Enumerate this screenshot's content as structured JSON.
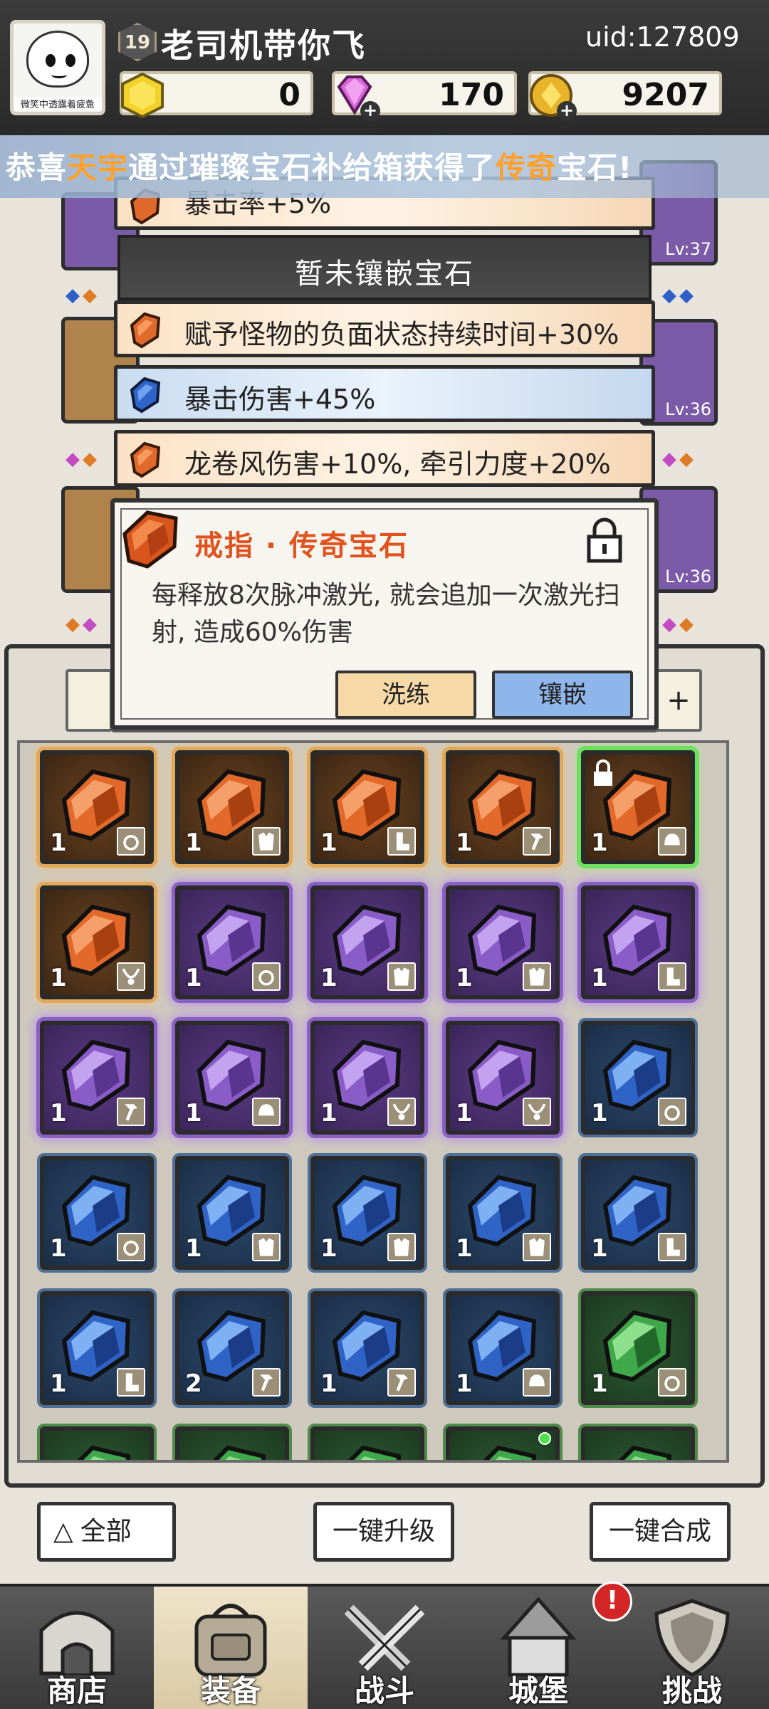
{
  "header": {
    "avatar_caption": "微笑中透露着疲惫",
    "level": "19",
    "player_name": "老司机带你飞",
    "uid": "uid:127809",
    "currencies": [
      {
        "icon": "gold-hexagon-icon",
        "value": "0"
      },
      {
        "icon": "purple-diamond-icon",
        "value": "170"
      },
      {
        "icon": "gold-coin-icon",
        "value": "9207"
      }
    ]
  },
  "marquee": {
    "prefix": "恭喜",
    "player": "天宇",
    "middle": "通过璀璨宝石补给箱获得了",
    "item": "传奇",
    "suffix": "宝石!"
  },
  "equipment_levels": [
    "Lv:37",
    "Lv:36",
    "Lv:36"
  ],
  "attributes": {
    "top_partial": "暴击率+5%",
    "empty_slot": "暂未镶嵌宝石",
    "list": [
      {
        "text": "赋予怪物的负面状态持续时间+30%",
        "gem": "orange"
      },
      {
        "text": "暴击伤害+45%",
        "gem": "blue"
      },
      {
        "text": "龙卷风伤害+10%, 牵引力度+20%",
        "gem": "orange"
      }
    ]
  },
  "popup": {
    "title": "戒指 · 传奇宝石",
    "description": "每释放8次脉冲激光, 就会追加一次激光扫射, 造成60%伤害",
    "refine_label": "洗练",
    "inlay_label": "镶嵌"
  },
  "inventory": {
    "tab_right": "+",
    "cells": [
      {
        "rarity": "orange",
        "count": "1",
        "slot": "ring"
      },
      {
        "rarity": "orange",
        "count": "1",
        "slot": "armor"
      },
      {
        "rarity": "orange",
        "count": "1",
        "slot": "boots"
      },
      {
        "rarity": "orange",
        "count": "1",
        "slot": "weapon"
      },
      {
        "rarity": "orange",
        "count": "1",
        "slot": "helmet",
        "locked": true,
        "selected": true
      },
      {
        "rarity": "orange",
        "count": "1",
        "slot": "necklace"
      },
      {
        "rarity": "purple",
        "count": "1",
        "slot": "ring"
      },
      {
        "rarity": "purple",
        "count": "1",
        "slot": "armor"
      },
      {
        "rarity": "purple",
        "count": "1",
        "slot": "armor"
      },
      {
        "rarity": "purple",
        "count": "1",
        "slot": "boots"
      },
      {
        "rarity": "purple",
        "count": "1",
        "slot": "weapon"
      },
      {
        "rarity": "purple",
        "count": "1",
        "slot": "helmet"
      },
      {
        "rarity": "purple",
        "count": "1",
        "slot": "necklace"
      },
      {
        "rarity": "purple",
        "count": "1",
        "slot": "necklace"
      },
      {
        "rarity": "blue",
        "count": "1",
        "slot": "ring"
      },
      {
        "rarity": "blue",
        "count": "1",
        "slot": "ring"
      },
      {
        "rarity": "blue",
        "count": "1",
        "slot": "armor"
      },
      {
        "rarity": "blue",
        "count": "1",
        "slot": "armor"
      },
      {
        "rarity": "blue",
        "count": "1",
        "slot": "armor"
      },
      {
        "rarity": "blue",
        "count": "1",
        "slot": "boots"
      },
      {
        "rarity": "blue",
        "count": "1",
        "slot": "boots"
      },
      {
        "rarity": "blue",
        "count": "2",
        "slot": "weapon"
      },
      {
        "rarity": "blue",
        "count": "1",
        "slot": "weapon"
      },
      {
        "rarity": "blue",
        "count": "1",
        "slot": "helmet"
      },
      {
        "rarity": "green",
        "count": "1",
        "slot": "ring"
      },
      {
        "rarity": "green",
        "count": "",
        "slot": ""
      },
      {
        "rarity": "green",
        "count": "",
        "slot": ""
      },
      {
        "rarity": "green",
        "count": "",
        "slot": ""
      },
      {
        "rarity": "green",
        "count": "",
        "slot": "",
        "dot": true
      },
      {
        "rarity": "green",
        "count": "",
        "slot": ""
      }
    ]
  },
  "actions": {
    "all_label": "全部",
    "upgrade_label": "一键升级",
    "merge_label": "一键合成"
  },
  "nav": {
    "items": [
      {
        "label": "商店",
        "icon": "shop-icon"
      },
      {
        "label": "装备",
        "icon": "backpack-icon",
        "active": true
      },
      {
        "label": "战斗",
        "icon": "crossed-swords-icon"
      },
      {
        "label": "城堡",
        "icon": "castle-icon"
      },
      {
        "label": "挑战",
        "icon": "shield-icon"
      }
    ],
    "badge": "!"
  },
  "colors": {
    "legendary": "#e0531e",
    "highlight": "#ffa12b",
    "epic": "#8b60c5",
    "rare": "#4d6f98",
    "uncommon": "#4e8c4c"
  }
}
